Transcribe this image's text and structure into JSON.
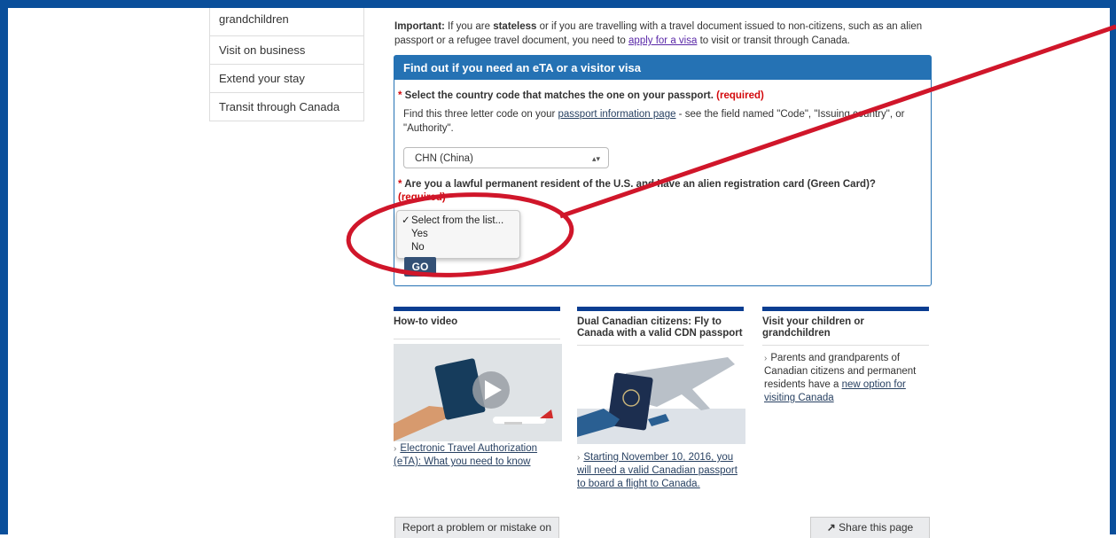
{
  "sidebar": {
    "items": [
      {
        "label": "grandchildren"
      },
      {
        "label": "Visit on business"
      },
      {
        "label": "Extend your stay"
      },
      {
        "label": "Transit through Canada"
      }
    ]
  },
  "notice": {
    "strong_label": "Important:",
    "text_1": " If you are ",
    "stateless": "stateless",
    "text_2": " or if you are travelling with a travel document issued to non-citizens, such as an alien passport or a refugee travel document, you need to ",
    "link": "apply for a visa",
    "text_3": " to visit or transit through Canada."
  },
  "form": {
    "title": "Find out if you need an eTA or a visitor visa",
    "q1_star": "*",
    "q1_label": " Select the country code that matches the one on your passport.",
    "required": "(required)",
    "help_1": "Find this three letter code on your ",
    "help_link": "passport information page",
    "help_2": " - see the field named \"Code\", \"Issuing country\", or \"Authority\".",
    "country_value": "CHN (China)",
    "select_arrows": "▴▾",
    "q2_star": "*",
    "q2_label": " Are you a lawful permanent resident of the U.S. and have an alien registration card (Green Card)?",
    "dropdown_options": [
      {
        "label": "Select from the list...",
        "check": "✓"
      },
      {
        "label": "Yes",
        "check": ""
      },
      {
        "label": "No",
        "check": ""
      }
    ],
    "go_label": "GO"
  },
  "cards": [
    {
      "title": "How-to video",
      "link": "Electronic Travel Authorization (eTA): What you need to know"
    },
    {
      "title": "Dual Canadian citizens: Fly to Canada with a valid CDN passport",
      "link": "Starting November 10, 2016, you will need a valid Canadian passport to board a flight to Canada."
    },
    {
      "title": "Visit your children or grandchildren",
      "text": "Parents and grandparents of Canadian citizens and permanent residents have a ",
      "link": "new option for visiting Canada"
    }
  ],
  "footer": {
    "report_label": "Report a problem or mistake on",
    "share_label": "Share this page",
    "share_icon": "share-icon"
  },
  "colors": {
    "frame": "#0a4f9b",
    "panel_header": "#2572b4",
    "required": "#d3080c",
    "annotation": "#d0162a",
    "go_button": "#335075"
  }
}
